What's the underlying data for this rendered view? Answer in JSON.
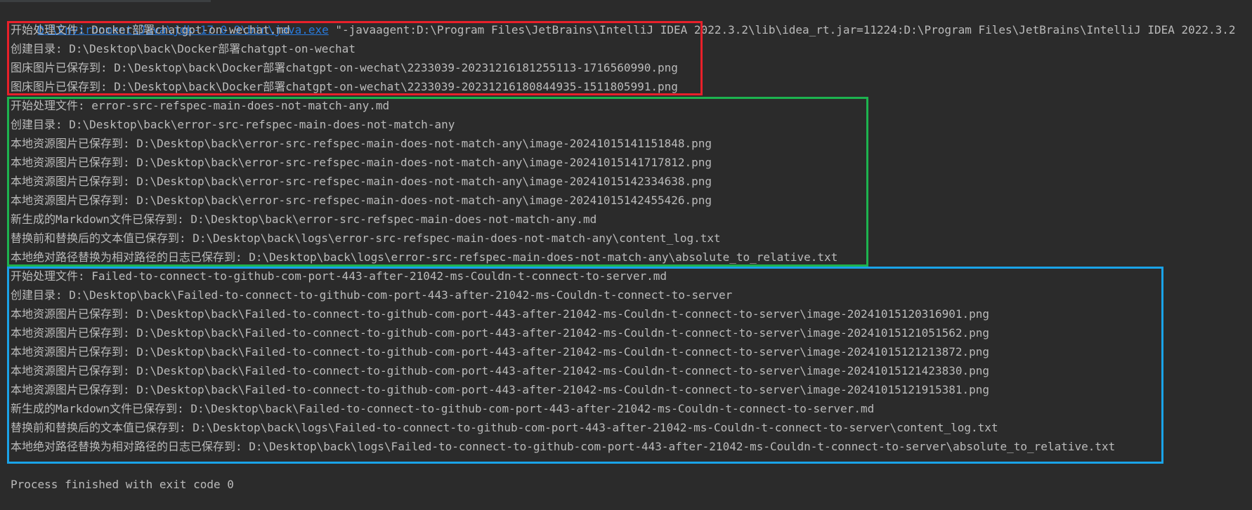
{
  "console": {
    "command": {
      "exe_link": "D:\\Environment\\Java\\jdk-17.0.9\\bin\\java.exe",
      "args": " \"-javaagent:D:\\Program Files\\JetBrains\\IntelliJ IDEA 2022.3.2\\lib\\idea_rt.jar=11224:D:\\Program Files\\JetBrains\\IntelliJ IDEA 2022.3.2"
    },
    "lines": [
      "开始处理文件: Docker部署chatgpt-on-wechat.md",
      "创建目录: D:\\Desktop\\back\\Docker部署chatgpt-on-wechat",
      "图床图片已保存到: D:\\Desktop\\back\\Docker部署chatgpt-on-wechat\\2233039-20231216181255113-1716560990.png",
      "图床图片已保存到: D:\\Desktop\\back\\Docker部署chatgpt-on-wechat\\2233039-20231216180844935-1511805991.png",
      "开始处理文件: error-src-refspec-main-does-not-match-any.md",
      "创建目录: D:\\Desktop\\back\\error-src-refspec-main-does-not-match-any",
      "本地资源图片已保存到: D:\\Desktop\\back\\error-src-refspec-main-does-not-match-any\\image-20241015141151848.png",
      "本地资源图片已保存到: D:\\Desktop\\back\\error-src-refspec-main-does-not-match-any\\image-20241015141717812.png",
      "本地资源图片已保存到: D:\\Desktop\\back\\error-src-refspec-main-does-not-match-any\\image-20241015142334638.png",
      "本地资源图片已保存到: D:\\Desktop\\back\\error-src-refspec-main-does-not-match-any\\image-20241015142455426.png",
      "新生成的Markdown文件已保存到: D:\\Desktop\\back\\error-src-refspec-main-does-not-match-any.md",
      "替换前和替换后的文本值已保存到: D:\\Desktop\\back\\logs\\error-src-refspec-main-does-not-match-any\\content_log.txt",
      "本地绝对路径替换为相对路径的日志已保存到: D:\\Desktop\\back\\logs\\error-src-refspec-main-does-not-match-any\\absolute_to_relative.txt",
      "开始处理文件: Failed-to-connect-to-github-com-port-443-after-21042-ms-Couldn-t-connect-to-server.md",
      "创建目录: D:\\Desktop\\back\\Failed-to-connect-to-github-com-port-443-after-21042-ms-Couldn-t-connect-to-server",
      "本地资源图片已保存到: D:\\Desktop\\back\\Failed-to-connect-to-github-com-port-443-after-21042-ms-Couldn-t-connect-to-server\\image-20241015120316901.png",
      "本地资源图片已保存到: D:\\Desktop\\back\\Failed-to-connect-to-github-com-port-443-after-21042-ms-Couldn-t-connect-to-server\\image-20241015121051562.png",
      "本地资源图片已保存到: D:\\Desktop\\back\\Failed-to-connect-to-github-com-port-443-after-21042-ms-Couldn-t-connect-to-server\\image-20241015121213872.png",
      "本地资源图片已保存到: D:\\Desktop\\back\\Failed-to-connect-to-github-com-port-443-after-21042-ms-Couldn-t-connect-to-server\\image-20241015121423830.png",
      "本地资源图片已保存到: D:\\Desktop\\back\\Failed-to-connect-to-github-com-port-443-after-21042-ms-Couldn-t-connect-to-server\\image-20241015121915381.png",
      "新生成的Markdown文件已保存到: D:\\Desktop\\back\\Failed-to-connect-to-github-com-port-443-after-21042-ms-Couldn-t-connect-to-server.md",
      "替换前和替换后的文本值已保存到: D:\\Desktop\\back\\logs\\Failed-to-connect-to-github-com-port-443-after-21042-ms-Couldn-t-connect-to-server\\content_log.txt",
      "本地绝对路径替换为相对路径的日志已保存到: D:\\Desktop\\back\\logs\\Failed-to-connect-to-github-com-port-443-after-21042-ms-Couldn-t-connect-to-server\\absolute_to_relative.txt"
    ],
    "finish_line": "Process finished with exit code 0"
  },
  "colors": {
    "background": "#2b2b2b",
    "text": "#bbbbbb",
    "link": "#287bde",
    "box_red": "#e8202a",
    "box_green": "#1db34f",
    "box_blue": "#1aa3e8"
  }
}
